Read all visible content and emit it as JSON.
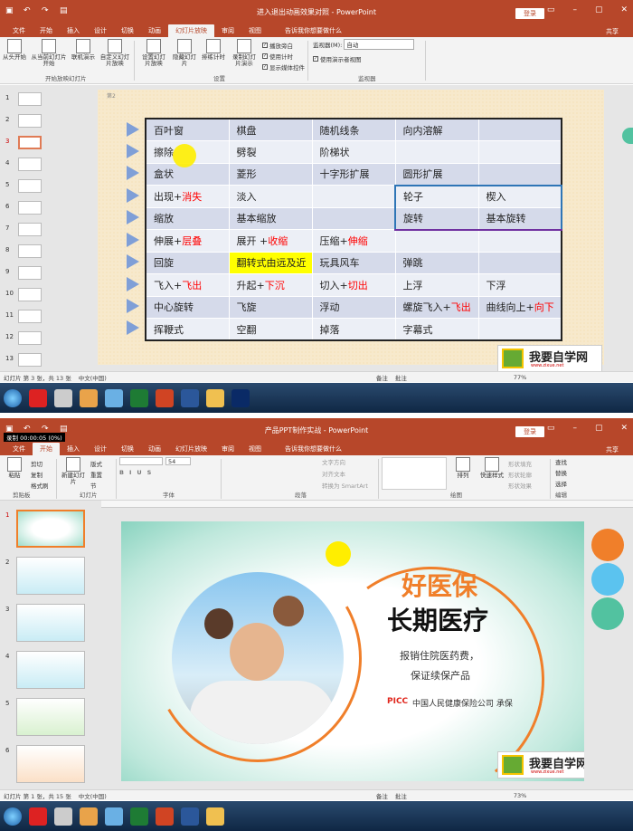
{
  "colors": {
    "accent": "#b7472a",
    "orange": "#f07f2a",
    "teal": "#52c2a0"
  },
  "w1": {
    "title": "进入退出动画效果对照 - PowerPoint",
    "login": "登录",
    "tabs": [
      "文件",
      "开始",
      "插入",
      "设计",
      "切换",
      "动画",
      "幻灯片放映",
      "审阅",
      "视图"
    ],
    "active_tab": "幻灯片放映",
    "tell": "告诉我你想要做什么",
    "share": "共享",
    "ribbon": {
      "g1": [
        "从头开始",
        "从当前幻灯片开始",
        "联机演示",
        "自定义幻灯片放映"
      ],
      "g1_label": "开始放映幻灯片",
      "g2": [
        "设置幻灯片放映",
        "隐藏幻灯片",
        "排练计时",
        "录制幻灯片演示"
      ],
      "g2_label": "设置",
      "checks": [
        "播放旁白",
        "使用计时",
        "显示媒体控件"
      ],
      "monitor_label": "监视器(M):",
      "monitor_value": "自动",
      "presenter": "使用演示者视图",
      "g3_label": "监视器"
    },
    "thumbs": [
      "1",
      "2",
      "3",
      "4",
      "5",
      "6",
      "7",
      "8",
      "9",
      "10",
      "11",
      "12",
      "13"
    ],
    "slide_tag": "第2",
    "table": [
      [
        "百叶窗",
        "棋盘",
        "随机线条",
        "向内溶解",
        ""
      ],
      [
        "擦除",
        "劈裂",
        "阶梯状",
        "",
        ""
      ],
      [
        "盒状",
        "菱形",
        "十字形扩展",
        "圆形扩展",
        ""
      ],
      [
        "出现+消失",
        "淡入",
        "",
        "轮子",
        "楔入"
      ],
      [
        "缩放",
        "基本缩放",
        "",
        "旋转",
        "基本旋转"
      ],
      [
        "伸展+层叠",
        "展开 +收缩",
        "压缩+伸缩",
        "",
        ""
      ],
      [
        "回旋",
        "翻转式由远及近",
        "玩具风车",
        "弹跳",
        ""
      ],
      [
        "飞入+飞出",
        "升起+下沉",
        "切入+切出",
        "上浮",
        "下浮"
      ],
      [
        "中心旋转",
        "飞旋",
        "浮动",
        "螺旋飞入+飞出",
        "曲线向上+向下"
      ],
      [
        "挥鞭式",
        "空翻",
        "掉落",
        "字幕式",
        ""
      ]
    ],
    "status": {
      "slide": "幻灯片 第 3 张，共 13 张",
      "lang": "中文(中国)",
      "notes": "备注",
      "comments": "批注",
      "zoom": "77%"
    },
    "logo": {
      "text": "我要自学网",
      "url": "www.zixue.net"
    }
  },
  "w2": {
    "title": "产品PPT制作实战 - PowerPoint",
    "login": "登录",
    "tabs": [
      "文件",
      "开始",
      "插入",
      "设计",
      "切换",
      "动画",
      "幻灯片放映",
      "审阅",
      "视图"
    ],
    "active_tab": "开始",
    "tell": "告诉我你想要做什么",
    "share": "共享",
    "recording": "录制 00:00:05 (0%)",
    "ribbon": {
      "paste": "粘贴",
      "cut": "剪切",
      "copy": "复制",
      "painter": "格式刷",
      "clip_label": "剪贴板",
      "new_slide": "新建幻灯片",
      "layout": "版式",
      "reset": "重置",
      "section": "节",
      "slides_label": "幻灯片",
      "font_size": "54",
      "font_label": "字体",
      "para_label": "段落",
      "text_dir": "文字方向",
      "align": "对齐文本",
      "smartart": "转换为 SmartArt",
      "arrange": "排列",
      "quick_styles": "快速样式",
      "draw_label": "绘图",
      "fill": "形状填充",
      "outline": "形状轮廓",
      "effect": "形状效果",
      "find": "查找",
      "replace": "替换",
      "select": "选择",
      "edit_label": "编辑"
    },
    "thumbs": [
      "1",
      "2",
      "3",
      "4",
      "5",
      "6"
    ],
    "slide": {
      "h1": "好医保",
      "h2": "长期医疗",
      "line1": "报销住院医药费，",
      "line2": "保证续保产品",
      "brand": "PICC",
      "company": "中国人民健康保险公司  承保"
    },
    "status": {
      "slide": "幻灯片 第 1 张，共 15 张",
      "lang": "中文(中国)",
      "notes": "备注",
      "comments": "批注",
      "zoom": "73%"
    },
    "logo": {
      "text": "我要自学网",
      "url": "www.zixue.net"
    },
    "swatches": [
      "#f07f2a",
      "#5bc3ef",
      "#52c2a0"
    ]
  }
}
